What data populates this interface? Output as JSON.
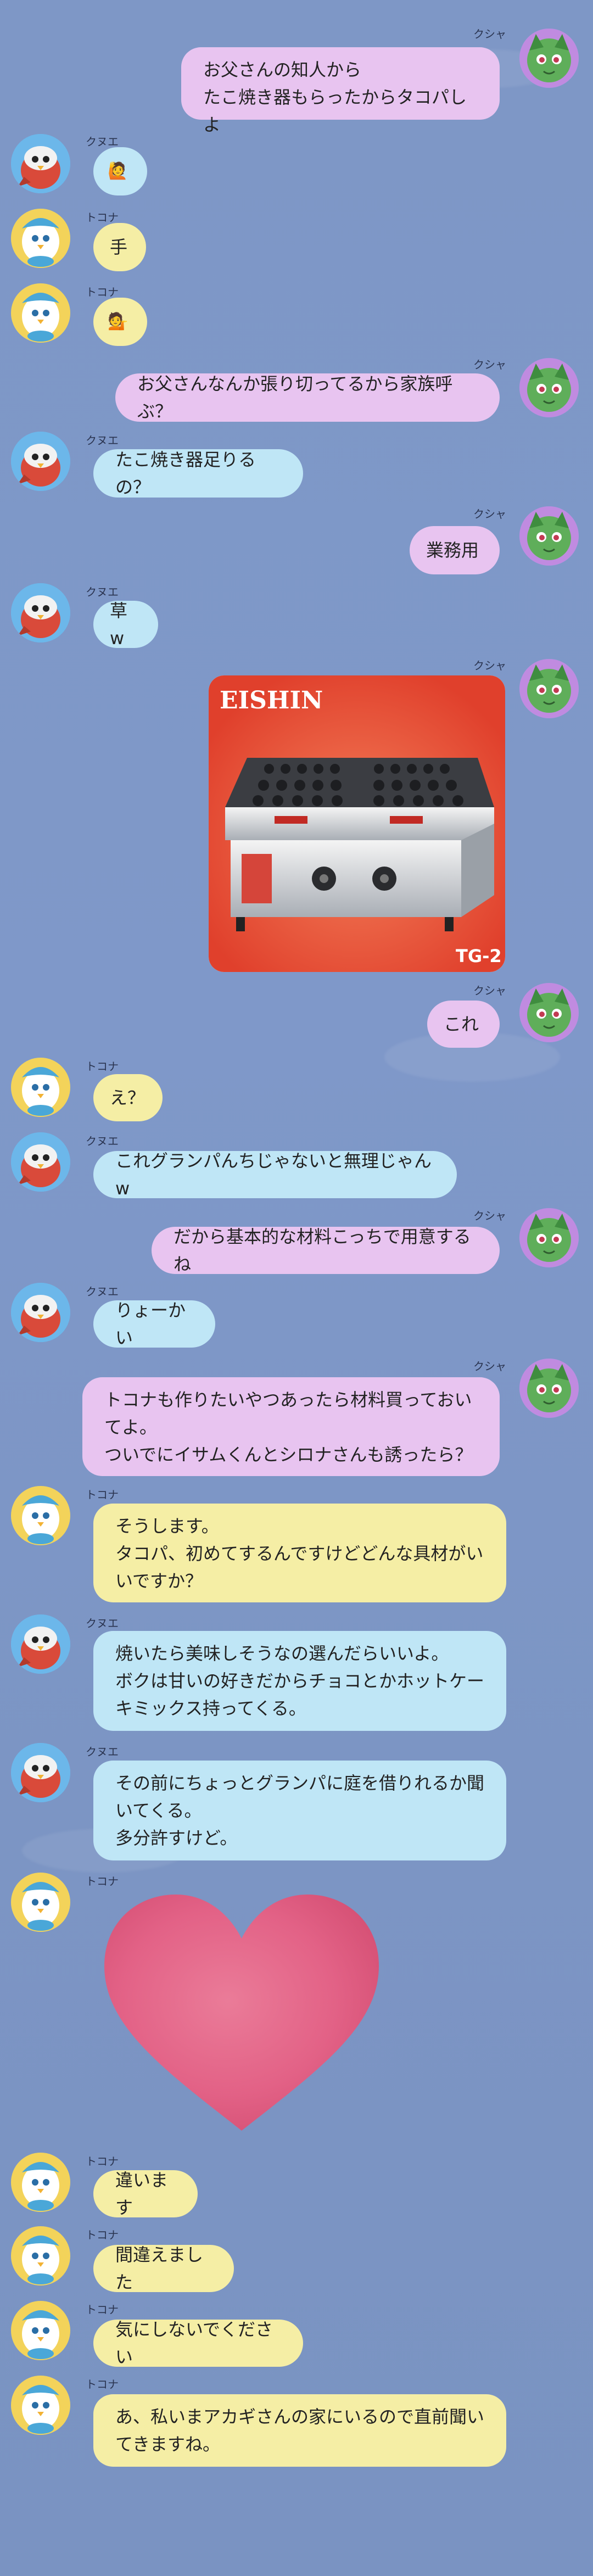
{
  "colors": {
    "kusha": "#e8c4f0",
    "kuwe": "#bfe6f6",
    "tokona": "#f5eea5",
    "background": "#7e97c6"
  },
  "messages": [
    {
      "sender": "クシャ",
      "text": "お父さんの知人から\nたこ焼き器もらったからタコパしよ"
    },
    {
      "sender": "クヌエ",
      "text": "🙋"
    },
    {
      "sender": "トコナ",
      "text": "手"
    },
    {
      "sender": "トコナ",
      "text": "💁"
    },
    {
      "sender": "クシャ",
      "text": "お父さんなんか張り切ってるから家族呼ぶ？"
    },
    {
      "sender": "クヌエ",
      "text": "たこ焼き器足りるの？"
    },
    {
      "sender": "クシャ",
      "text": "業務用"
    },
    {
      "sender": "クヌエ",
      "text": "草w"
    },
    {
      "sender": "クシャ",
      "image": {
        "brand": "EISHIN",
        "model": "TG-2"
      }
    },
    {
      "sender": "クシャ",
      "text": "これ"
    },
    {
      "sender": "トコナ",
      "text": "え？"
    },
    {
      "sender": "クヌエ",
      "text": "これグランパんちじゃないと無理じゃんw"
    },
    {
      "sender": "クシャ",
      "text": "だから基本的な材料こっちで用意するね"
    },
    {
      "sender": "クヌエ",
      "text": "りょーかい"
    },
    {
      "sender": "クシャ",
      "text": "トコナも作りたいやつあったら材料買っておい\nてよ。\nついでにイサムくんとシロナさんも誘ったら？"
    },
    {
      "sender": "トコナ",
      "text": "そうします。\nタコパ、初めてするんですけどどんな具材がい\nいですか？"
    },
    {
      "sender": "クヌエ",
      "text": "焼いたら美味しそうなの選んだらいいよ。\nボクは甘いの好きだからチョコとかホットケー\nキミックス持ってくる。"
    },
    {
      "sender": "クヌエ",
      "text": "その前にちょっとグランパに庭を借りれるか聞\nいてくる。\n多分許すけど。"
    },
    {
      "sender": "トコナ",
      "sticker": "heart"
    },
    {
      "sender": "トコナ",
      "text": "違います"
    },
    {
      "sender": "トコナ",
      "text": "間違えました"
    },
    {
      "sender": "トコナ",
      "text": "気にしないでください"
    },
    {
      "sender": "トコナ",
      "text": "あ、私いまアカギさんの家にいるので直前聞い\nてきますね。"
    }
  ]
}
